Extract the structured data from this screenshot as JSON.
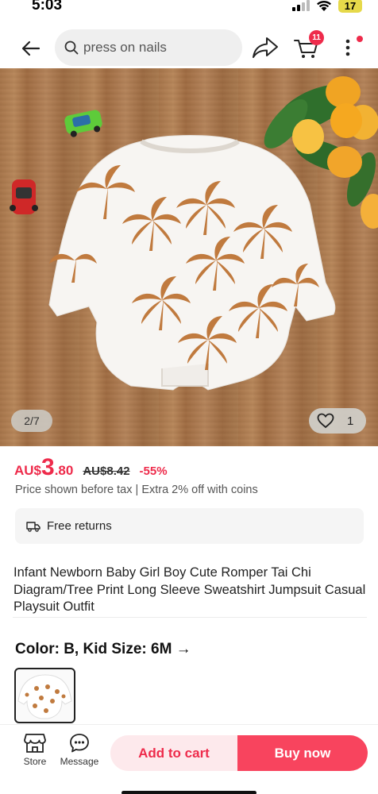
{
  "status_bar": {
    "time": "5:03",
    "battery": "17"
  },
  "search": {
    "placeholder": "press on nails"
  },
  "header": {
    "cart_count": "11"
  },
  "gallery": {
    "counter": "2/7",
    "likes": "1"
  },
  "price": {
    "currency": "AU$",
    "integer": "3",
    "decimal": ".80",
    "original": "AU$8.42",
    "discount": "-55%"
  },
  "tax_note": "Price shown before tax | Extra 2% off with coins",
  "returns": {
    "label": "Free returns"
  },
  "product": {
    "title": "Infant Newborn Baby Girl Boy Cute Romper Tai Chi Diagram/Tree Print Long Sleeve Sweatshirt Jumpsuit Casual Playsuit Outfit"
  },
  "variant": {
    "label": "Color: B, Kid Size: 6M →"
  },
  "bottom_bar": {
    "store_label": "Store",
    "message_label": "Message",
    "add_to_cart": "Add to cart",
    "buy_now": "Buy now"
  },
  "colors": {
    "accent": "#ee2b4b",
    "buy_now_bg": "#f8445e",
    "add_cart_bg": "#fde9ec"
  }
}
